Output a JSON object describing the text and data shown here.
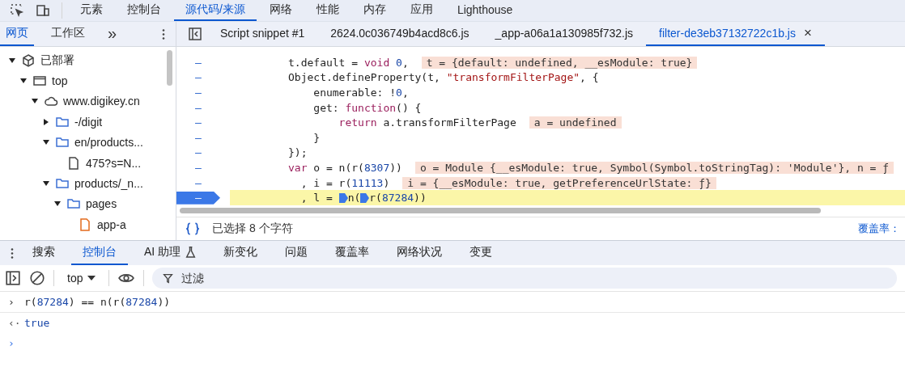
{
  "main_tabs": [
    {
      "label": "元素",
      "selected": false
    },
    {
      "label": "控制台",
      "selected": false
    },
    {
      "label": "源代码/来源",
      "selected": true
    },
    {
      "label": "网络",
      "selected": false
    },
    {
      "label": "性能",
      "selected": false
    },
    {
      "label": "内存",
      "selected": false
    },
    {
      "label": "应用",
      "selected": false
    },
    {
      "label": "Lighthouse",
      "selected": false
    }
  ],
  "sidebar": {
    "tabs": [
      {
        "label": "网页",
        "selected": true
      },
      {
        "label": "工作区",
        "selected": false
      }
    ],
    "more": "»",
    "tree": [
      {
        "label": "已部署",
        "kind": "deployed",
        "expanded": true,
        "children": [
          {
            "label": "top",
            "kind": "frame",
            "expanded": true,
            "children": [
              {
                "label": "www.digikey.cn",
                "kind": "cloud",
                "expanded": true,
                "children": [
                  {
                    "label": "-/digit",
                    "kind": "folder",
                    "expanded": false
                  },
                  {
                    "label": "en/products...",
                    "kind": "folder",
                    "expanded": true,
                    "children": [
                      {
                        "label": "475?s=N...",
                        "kind": "file"
                      }
                    ]
                  },
                  {
                    "label": "products/_n...",
                    "kind": "folder",
                    "expanded": true,
                    "children": [
                      {
                        "label": "pages",
                        "kind": "folder",
                        "expanded": true,
                        "children": [
                          {
                            "label": "app-a",
                            "kind": "script"
                          }
                        ]
                      }
                    ]
                  }
                ]
              }
            ]
          }
        ]
      }
    ]
  },
  "editor_tabs": [
    {
      "label": "Script snippet #1",
      "selected": false
    },
    {
      "label": "2624.0c036749b4acd8c6.js",
      "selected": false
    },
    {
      "label": "_app-a06a1a130985f732.js",
      "selected": false
    },
    {
      "label": "filter-de3eb37132722c1b.js",
      "selected": true,
      "close": "×"
    }
  ],
  "code_lines": [
    {
      "gutter": "–",
      "current": false,
      "tokens": [
        {
          "kind": "plain",
          "t": "t.default = "
        },
        {
          "kind": "kw",
          "t": "void"
        },
        {
          "kind": "num",
          "t": " 0"
        },
        {
          "kind": "plain",
          "t": ","
        }
      ],
      "value": "t = {default: undefined, __esModule: true}"
    },
    {
      "gutter": "–",
      "current": false,
      "tokens": [
        {
          "kind": "plain",
          "t": "Object.defineProperty(t, "
        },
        {
          "kind": "str",
          "t": "\"transformFilterPage\""
        },
        {
          "kind": "plain",
          "t": ", {"
        }
      ]
    },
    {
      "gutter": "–",
      "current": false,
      "tokens": [
        {
          "kind": "plain",
          "t": "    enumerable: !"
        },
        {
          "kind": "num",
          "t": "0"
        },
        {
          "kind": "plain",
          "t": ","
        }
      ]
    },
    {
      "gutter": "–",
      "current": false,
      "tokens": [
        {
          "kind": "plain",
          "t": "    get: "
        },
        {
          "kind": "kw",
          "t": "function"
        },
        {
          "kind": "plain",
          "t": "() {"
        }
      ]
    },
    {
      "gutter": "–",
      "current": false,
      "tokens": [
        {
          "kind": "kw",
          "t": "        return"
        },
        {
          "kind": "plain",
          "t": " a.transformFilterPage"
        }
      ],
      "value": "a = undefined"
    },
    {
      "gutter": "–",
      "current": false,
      "tokens": [
        {
          "kind": "plain",
          "t": "    }"
        }
      ]
    },
    {
      "gutter": "–",
      "current": false,
      "tokens": [
        {
          "kind": "plain",
          "t": "});"
        }
      ]
    },
    {
      "gutter": "–",
      "current": false,
      "tokens": [
        {
          "kind": "kw",
          "t": "var"
        },
        {
          "kind": "plain",
          "t": " o = n(r("
        },
        {
          "kind": "num",
          "t": "8307"
        },
        {
          "kind": "plain",
          "t": "))"
        }
      ],
      "value": "o = Module {__esModule: true, Symbol(Symbol.toStringTag): 'Module'}, n = ƒ"
    },
    {
      "gutter": "–",
      "current": false,
      "tokens": [
        {
          "kind": "plain",
          "t": "  , i = r("
        },
        {
          "kind": "num",
          "t": "11113"
        },
        {
          "kind": "plain",
          "t": ")"
        }
      ],
      "value": "i = {__esModule: true, getPreferenceUrlState: ƒ}"
    },
    {
      "gutter": "–",
      "current": true,
      "tokens": [
        {
          "kind": "plain",
          "t": "  , l = "
        },
        {
          "kind": "marker"
        },
        {
          "kind": "plain",
          "t": "n("
        },
        {
          "kind": "marker"
        },
        {
          "kind": "plain",
          "t": "r("
        },
        {
          "kind": "num",
          "t": "87284"
        },
        {
          "kind": "plain",
          "t": "))"
        }
      ]
    }
  ],
  "status_bar": {
    "selection": "已选择 8 个字符",
    "coverage": "覆盖率："
  },
  "drawer_tabs": [
    {
      "label": "搜索",
      "selected": false
    },
    {
      "label": "控制台",
      "selected": true
    },
    {
      "label": "AI 助理",
      "selected": false,
      "flask": true
    },
    {
      "label": "新变化",
      "selected": false
    },
    {
      "label": "问题",
      "selected": false
    },
    {
      "label": "覆盖率",
      "selected": false
    },
    {
      "label": "网络状况",
      "selected": false
    },
    {
      "label": "变更",
      "selected": false
    }
  ],
  "console_toolbar": {
    "context": "top",
    "filter": {
      "placeholder": "过滤"
    }
  },
  "console": [
    {
      "kind": "input",
      "prompt": "›",
      "tokens": [
        {
          "kind": "plain",
          "t": "r("
        },
        {
          "kind": "num",
          "t": "87284"
        },
        {
          "kind": "plain",
          "t": ") == n(r("
        },
        {
          "kind": "num",
          "t": "87284"
        },
        {
          "kind": "plain",
          "t": "))"
        }
      ]
    },
    {
      "kind": "output",
      "prompt": "‹·",
      "tokens": [
        {
          "kind": "kw2",
          "t": "true"
        }
      ]
    },
    {
      "kind": "prompt",
      "prompt": "›"
    }
  ]
}
